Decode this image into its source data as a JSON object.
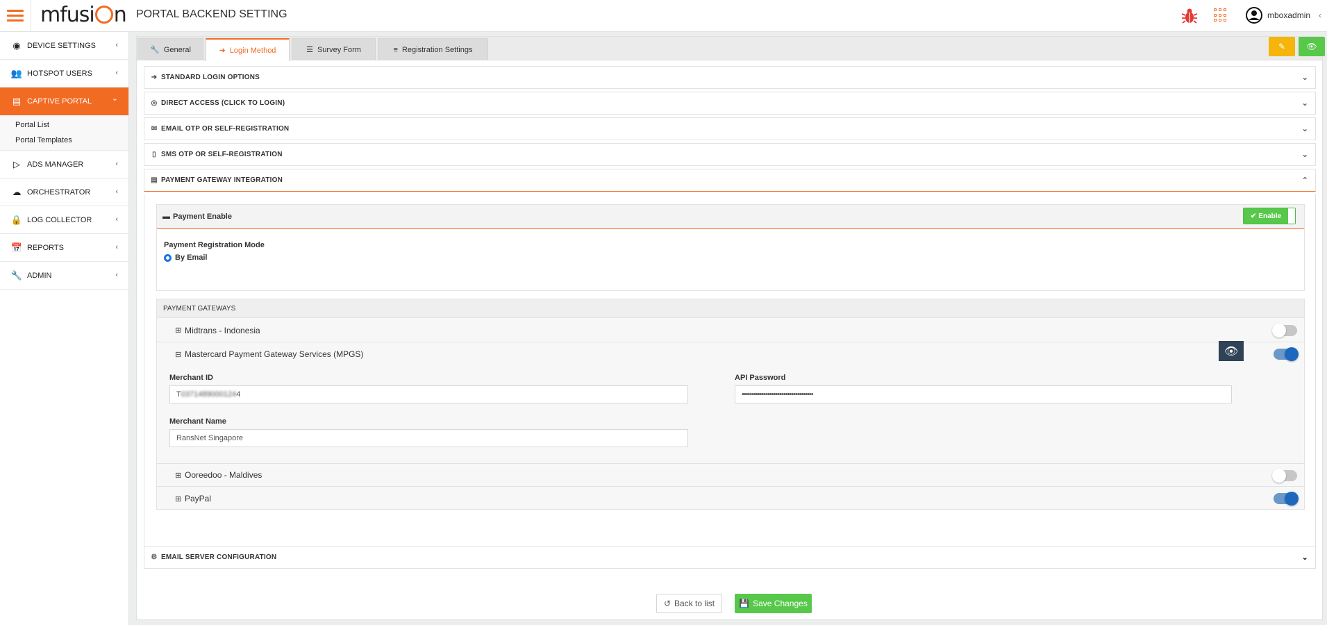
{
  "header": {
    "title": "PORTAL BACKEND SETTING",
    "logo": "mfusion",
    "username": "mboxadmin",
    "user_chevron": "‹"
  },
  "sidebar": {
    "items": [
      {
        "label": "DEVICE SETTINGS",
        "icon": "satellite-dish-icon",
        "chevron": "‹"
      },
      {
        "label": "HOTSPOT USERS",
        "icon": "users-icon",
        "chevron": "‹"
      },
      {
        "label": "CAPTIVE PORTAL",
        "icon": "portal-icon",
        "chevron": "⌄"
      },
      {
        "label": "ADS MANAGER",
        "icon": "play-icon",
        "chevron": "‹"
      },
      {
        "label": "ORCHESTRATOR",
        "icon": "cloud-icon",
        "chevron": "‹"
      },
      {
        "label": "LOG COLLECTOR",
        "icon": "lock-icon",
        "chevron": "‹"
      },
      {
        "label": "REPORTS",
        "icon": "calendar-icon",
        "chevron": "‹"
      },
      {
        "label": "ADMIN",
        "icon": "wrench-icon",
        "chevron": "‹"
      }
    ],
    "subitems": [
      "Portal List",
      "Portal Templates"
    ]
  },
  "tabs": [
    {
      "label": "General",
      "icon": "wrench-icon"
    },
    {
      "label": "Login Method",
      "icon": "sign-in-icon"
    },
    {
      "label": "Survey Form",
      "icon": "list-icon"
    },
    {
      "label": "Registration Settings",
      "icon": "sliders-icon"
    }
  ],
  "panels": {
    "standard": "STANDARD LOGIN OPTIONS",
    "direct": "DIRECT ACCESS (CLICK TO LOGIN)",
    "email_otp": "EMAIL OTP OR SELF-REGISTRATION",
    "sms_otp": "SMS OTP OR SELF-REGISTRATION",
    "payment": "PAYMENT GATEWAY INTEGRATION",
    "email_server": "EMAIL SERVER CONFIGURATION"
  },
  "payment": {
    "enable_title": "Payment Enable",
    "enable_toggle": "Enable",
    "mode_label": "Payment Registration Mode",
    "mode_option": "By Email"
  },
  "gateways": {
    "title": "PAYMENT GATEWAYS",
    "items": [
      {
        "name": "Midtrans - Indonesia",
        "enabled": false,
        "expanded": false
      },
      {
        "name": "Mastercard Payment Gateway Services (MPGS)",
        "enabled": true,
        "expanded": true
      },
      {
        "name": "Ooreedoo - Maldives",
        "enabled": false,
        "expanded": false
      },
      {
        "name": "PayPal",
        "enabled": true,
        "expanded": false
      }
    ],
    "plus": "⊞",
    "minus": "⊟"
  },
  "mpgs": {
    "merchant_id_label": "Merchant ID",
    "merchant_id_value": "T0371489000124",
    "merchant_id_first": "T",
    "merchant_id_last": "4",
    "merchant_name_label": "Merchant Name",
    "merchant_name_value": "RansNet Singapore",
    "api_password_label": "API Password",
    "api_password_value": "••••••••••••••••••••••••••••••••••••"
  },
  "footer": {
    "back_label": "Back to list",
    "save_label": "Save Changes"
  },
  "colors": {
    "accent": "#f26b23",
    "success": "#57c84a",
    "warning": "#f5b50a",
    "toggle_on": "#1d68bf",
    "dark_button": "#2f4256"
  }
}
